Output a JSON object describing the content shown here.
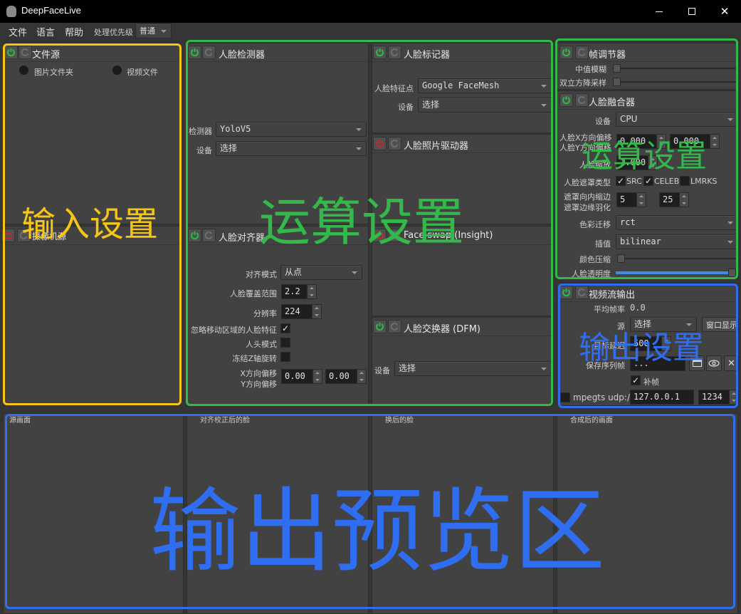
{
  "window": {
    "title": "DeepFaceLive",
    "minimize_icon": "minimize-icon",
    "maximize_icon": "maximize-icon",
    "close_icon": "close-icon"
  },
  "menubar": {
    "items": [
      "文件",
      "语言",
      "帮助"
    ],
    "priority_label": "处理优先级",
    "priority_value": "普通"
  },
  "colors": {
    "input_overlay": "#f5c518",
    "compute_overlay": "#33b84a",
    "output_overlay": "#2f6ef0",
    "power_on": "#2fb84a",
    "power_off": "#c0292b",
    "opacity_fill": "#3a8ee6"
  },
  "file_source": {
    "title": "文件源",
    "power": "on",
    "options": [
      "图片文件夹",
      "视频文件"
    ]
  },
  "camera_source": {
    "title": "摄像机源",
    "power": "off"
  },
  "face_detector": {
    "title": "人脸检测器",
    "power": "on",
    "detector_label": "检测器",
    "detector_value": "YoloV5",
    "device_label": "设备",
    "device_value": "选择"
  },
  "face_aligner": {
    "title": "人脸对齐器",
    "power": "on",
    "align_mode_label": "对齐模式",
    "align_mode_value": "从点",
    "face_coverage_label": "人脸覆盖范围",
    "face_coverage_value": "2.2",
    "resolution_label": "分辨率",
    "resolution_value": "224",
    "exclude_moving_label": "忽略移动区域的人脸特征",
    "exclude_moving_checked": "✓",
    "head_mode_label": "人头模式",
    "freeze_z_label": "冻结Z轴旋转",
    "x_offset_label": "X方向偏移",
    "y_offset_label": "Y方向偏移",
    "x_offset_value": "0.00",
    "y_offset_value": "0.00"
  },
  "face_marker": {
    "title": "人脸标记器",
    "power": "on",
    "landmarks_label": "人脸特征点",
    "landmarks_value": "Google FaceMesh",
    "device_label": "设备",
    "device_value": "选择"
  },
  "face_animator": {
    "title": "人脸照片驱动器",
    "power": "off"
  },
  "face_swap_insight": {
    "title": "Face swap (Insight)",
    "power": "off"
  },
  "face_swapper_dfm": {
    "title": "人脸交换器 (DFM)",
    "power": "on",
    "device_label": "设备",
    "device_value": "选择"
  },
  "frame_adjuster": {
    "title": "帧调节器",
    "power": "on",
    "median_blur_label": "中值模糊",
    "median_blur_value": 0,
    "bilateral_label": "双立方降采样",
    "bilateral_value": 0
  },
  "face_merger": {
    "title": "人脸融合器",
    "power": "on",
    "device_label": "设备",
    "device_value": "CPU",
    "x_offset_label": "人脸X方向偏移",
    "y_offset_label": "人脸Y方向偏移",
    "x_offset_value": "0.000",
    "y_offset_value": "0.000",
    "scale_label": "人脸缩放",
    "scale_value": "1.000",
    "mask_type_label": "人脸遮罩类型",
    "mask_src": "SRC",
    "mask_celeb": "CELEB",
    "mask_lmrks": "LMRKS",
    "mask_src_checked": "✓",
    "mask_celeb_checked": "✓",
    "erode_label": "遮罩向内缩边",
    "blur_label": "遮罩边缘羽化",
    "erode_value": "5",
    "blur_value": "25",
    "color_transfer_label": "色彩迁移",
    "color_transfer_value": "rct",
    "interpolation_label": "插值",
    "interpolation_value": "bilinear",
    "color_compression_label": "颜色压缩",
    "color_compression_value": 0,
    "opacity_label": "人脸透明度",
    "opacity_value": 1.0
  },
  "stream_output": {
    "title": "视频流输出",
    "power": "on",
    "avg_fps_label": "平均帧率",
    "avg_fps_value": "0.0",
    "source_label": "源",
    "source_value": "选择",
    "window_button": "窗口显示",
    "target_delay_label": "目标延迟",
    "target_delay_value": "500",
    "save_sequence_label": "保存序列帧",
    "save_path_value": "...",
    "fill_frame_label": "补帧",
    "fill_frame_checked": "✓",
    "mpegts_label": "mpegts udp://",
    "address_value": "127.0.0.1",
    "port_value": "1234"
  },
  "previews": [
    {
      "label": "源画面"
    },
    {
      "label": "对齐校正后的脸"
    },
    {
      "label": "换后的脸"
    },
    {
      "label": "合成后的画面"
    }
  ],
  "annotations": {
    "input": "输入设置",
    "compute": "运算设置",
    "compute_small": "运算设置",
    "output": "输出设置",
    "preview": "输出预览区"
  }
}
